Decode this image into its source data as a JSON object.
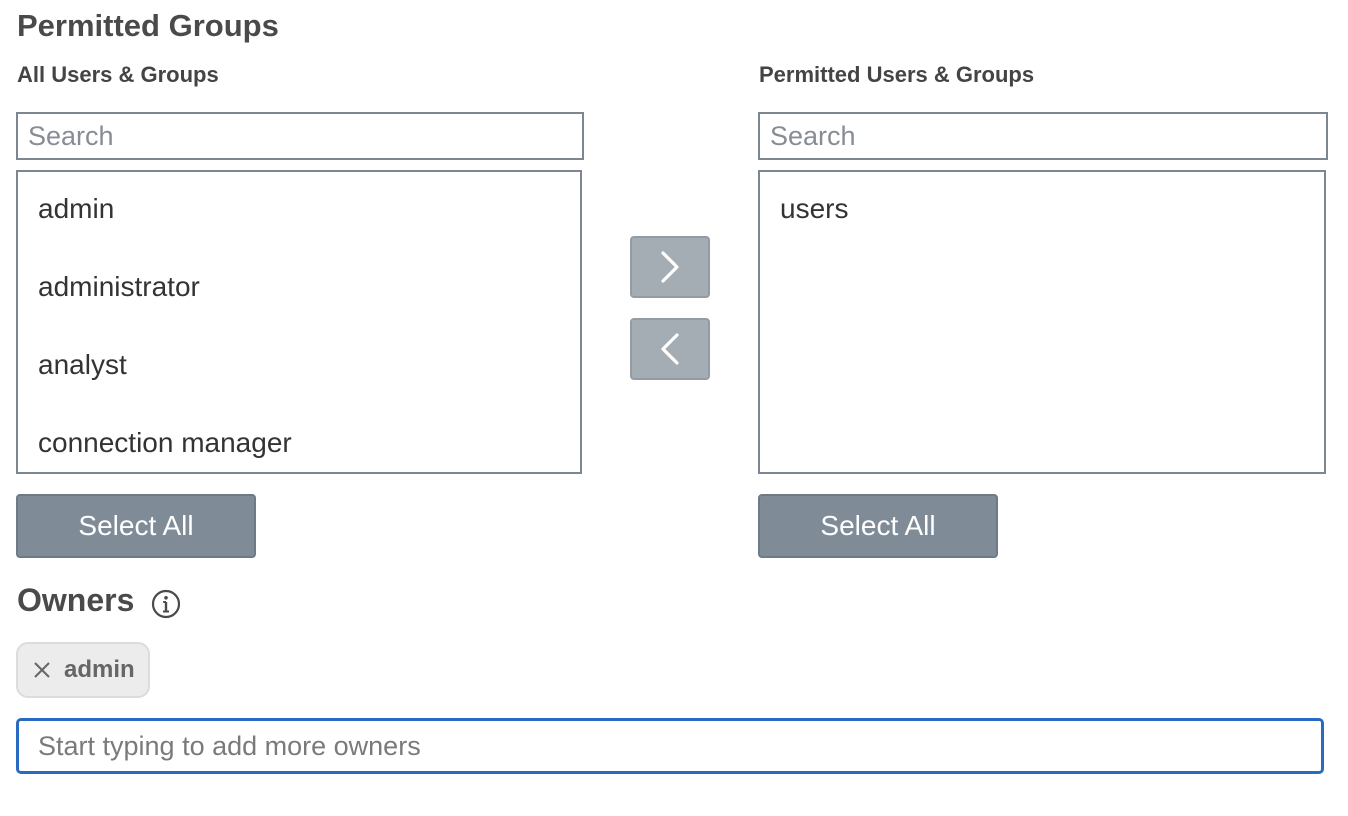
{
  "section_title": "Permitted Groups",
  "all_list": {
    "label": "All Users & Groups",
    "search_placeholder": "Search",
    "items": [
      "admin",
      "administrator",
      "analyst",
      "connection manager"
    ],
    "select_all_label": "Select All"
  },
  "permitted_list": {
    "label": "Permitted Users & Groups",
    "search_placeholder": "Search",
    "items": [
      "users"
    ],
    "select_all_label": "Select All"
  },
  "move_buttons": {
    "add_icon": "chevron-right-icon",
    "remove_icon": "chevron-left-icon"
  },
  "owners": {
    "title": "Owners",
    "info_icon": "info-icon",
    "chips": [
      {
        "label": "admin",
        "remove_icon": "close-icon"
      }
    ],
    "input_placeholder": "Start typing to add more owners"
  },
  "colors": {
    "focus_border": "#2a6ac2",
    "button_bg": "#7f8b96",
    "move_button_bg": "#a4adb4"
  }
}
